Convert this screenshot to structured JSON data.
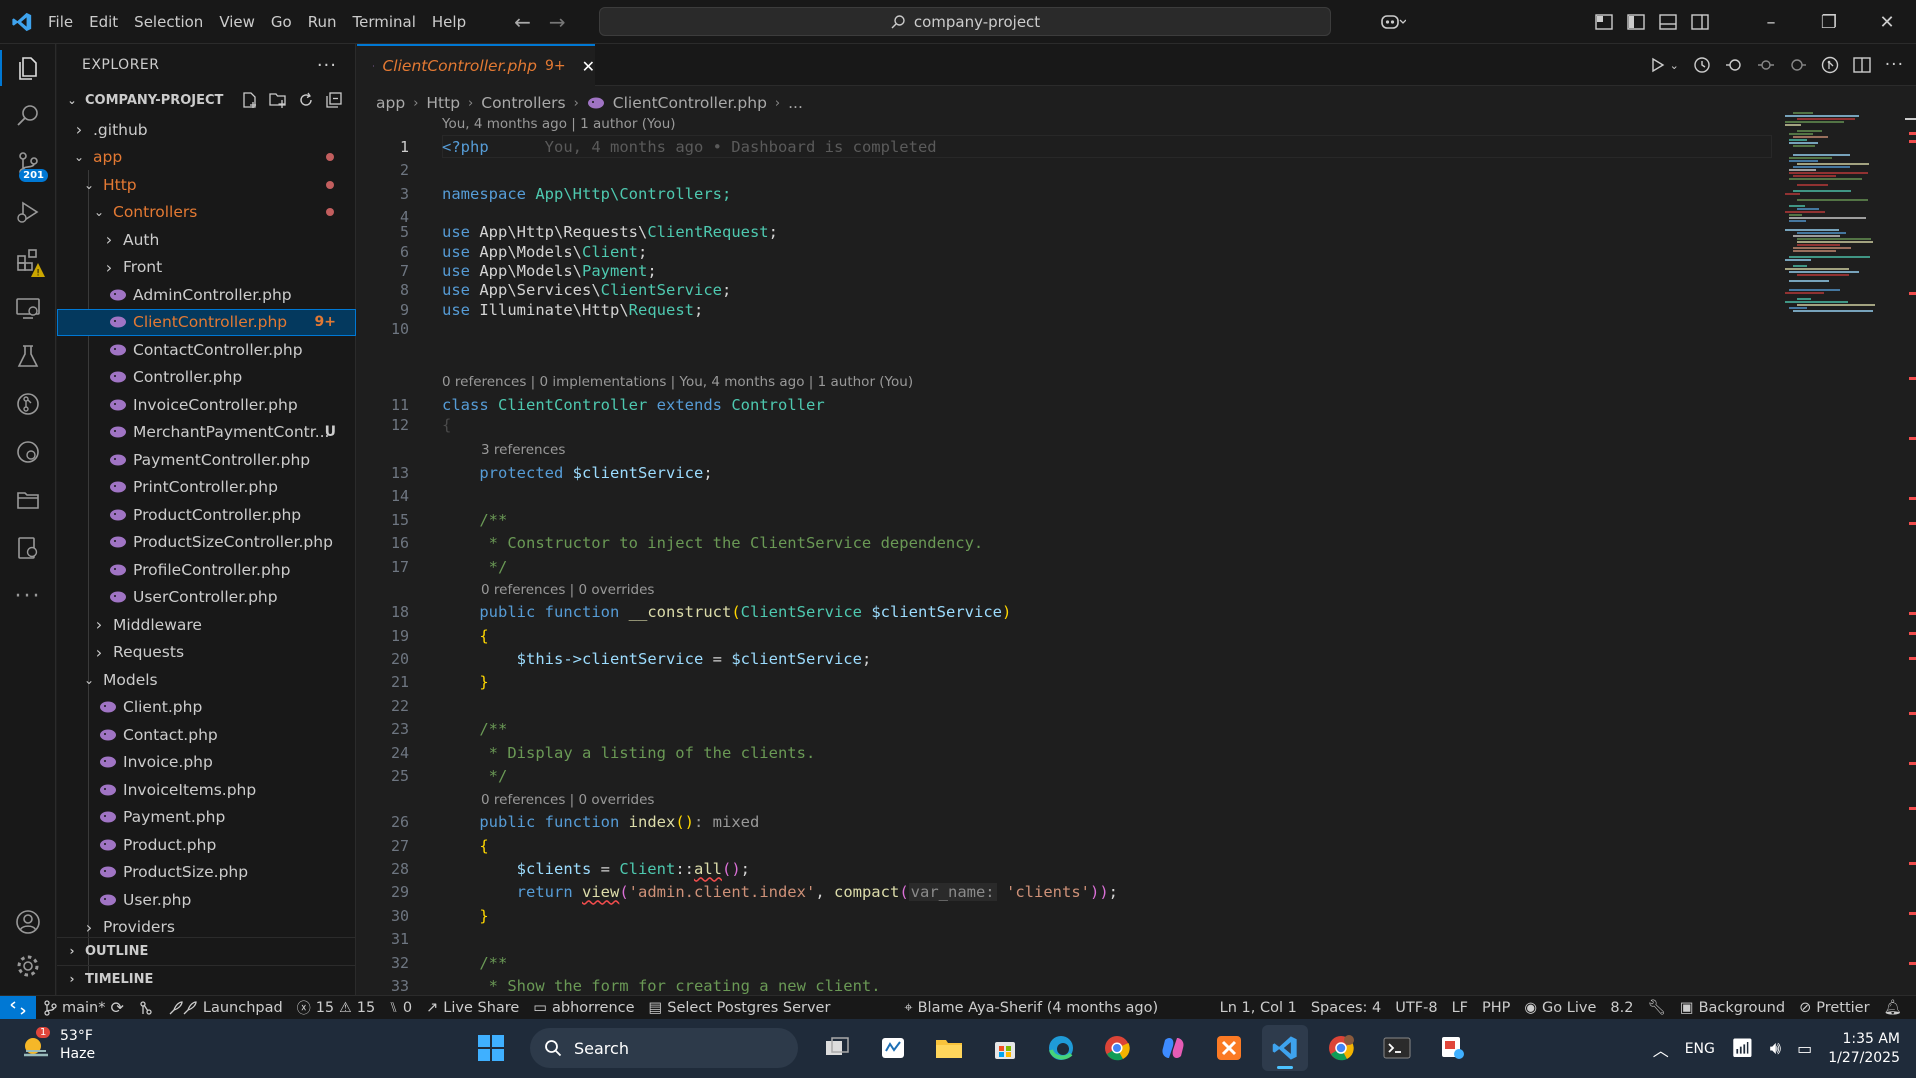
{
  "titlebar": {
    "menu": [
      "File",
      "Edit",
      "Selection",
      "View",
      "Go",
      "Run",
      "Terminal",
      "Help"
    ],
    "search": "company-project"
  },
  "activity": {
    "scm_badge": "201"
  },
  "explorer": {
    "title": "EXPLORER",
    "project": "COMPANY-PROJECT",
    "outline": "OUTLINE",
    "timeline": "TIMELINE",
    "tree": [
      {
        "label": ".github",
        "depth": 1,
        "type": "folder",
        "open": false,
        "color": "#cccccc"
      },
      {
        "label": "app",
        "depth": 1,
        "type": "folder",
        "open": true,
        "color": "#e37933",
        "dot": true
      },
      {
        "label": "Http",
        "depth": 2,
        "type": "folder",
        "open": true,
        "color": "#e37933",
        "dot": true
      },
      {
        "label": "Controllers",
        "depth": 3,
        "type": "folder",
        "open": true,
        "color": "#e37933",
        "dot": true
      },
      {
        "label": "Auth",
        "depth": 4,
        "type": "folder",
        "open": false,
        "color": "#cccccc"
      },
      {
        "label": "Front",
        "depth": 4,
        "type": "folder",
        "open": false,
        "color": "#cccccc"
      },
      {
        "label": "AdminController.php",
        "depth": 4,
        "type": "php",
        "color": "#cccccc"
      },
      {
        "label": "ClientController.php",
        "depth": 4,
        "type": "php",
        "color": "#e37933",
        "badge": "9+",
        "selected": true
      },
      {
        "label": "ContactController.php",
        "depth": 4,
        "type": "php",
        "color": "#cccccc"
      },
      {
        "label": "Controller.php",
        "depth": 4,
        "type": "php",
        "color": "#cccccc"
      },
      {
        "label": "InvoiceController.php",
        "depth": 4,
        "type": "php",
        "color": "#cccccc"
      },
      {
        "label": "MerchantPaymentContr...",
        "depth": 4,
        "type": "php",
        "color": "#cccccc",
        "badge": "U"
      },
      {
        "label": "PaymentController.php",
        "depth": 4,
        "type": "php",
        "color": "#cccccc"
      },
      {
        "label": "PrintController.php",
        "depth": 4,
        "type": "php",
        "color": "#cccccc"
      },
      {
        "label": "ProductController.php",
        "depth": 4,
        "type": "php",
        "color": "#cccccc"
      },
      {
        "label": "ProductSizeController.php",
        "depth": 4,
        "type": "php",
        "color": "#cccccc"
      },
      {
        "label": "ProfileController.php",
        "depth": 4,
        "type": "php",
        "color": "#cccccc"
      },
      {
        "label": "UserController.php",
        "depth": 4,
        "type": "php",
        "color": "#cccccc"
      },
      {
        "label": "Middleware",
        "depth": 3,
        "type": "folder",
        "open": false,
        "color": "#cccccc"
      },
      {
        "label": "Requests",
        "depth": 3,
        "type": "folder",
        "open": false,
        "color": "#cccccc"
      },
      {
        "label": "Models",
        "depth": 2,
        "type": "folder",
        "open": true,
        "color": "#cccccc"
      },
      {
        "label": "Client.php",
        "depth": 3,
        "type": "php",
        "color": "#cccccc"
      },
      {
        "label": "Contact.php",
        "depth": 3,
        "type": "php",
        "color": "#cccccc"
      },
      {
        "label": "Invoice.php",
        "depth": 3,
        "type": "php",
        "color": "#cccccc"
      },
      {
        "label": "InvoiceItems.php",
        "depth": 3,
        "type": "php",
        "color": "#cccccc"
      },
      {
        "label": "Payment.php",
        "depth": 3,
        "type": "php",
        "color": "#cccccc"
      },
      {
        "label": "Product.php",
        "depth": 3,
        "type": "php",
        "color": "#cccccc"
      },
      {
        "label": "ProductSize.php",
        "depth": 3,
        "type": "php",
        "color": "#cccccc"
      },
      {
        "label": "User.php",
        "depth": 3,
        "type": "php",
        "color": "#cccccc"
      },
      {
        "label": "Providers",
        "depth": 2,
        "type": "folder",
        "open": false,
        "color": "#cccccc"
      }
    ]
  },
  "editor": {
    "tab": {
      "label": "ClientController.php",
      "count": "9+"
    },
    "breadcrumb": [
      "app",
      "Http",
      "Controllers",
      "ClientController.php",
      "..."
    ],
    "blame_header": "You, 4 months ago | 1 author (You)",
    "line1_blame": "You, 4 months ago • Dashboard is completed",
    "lens_class": "0 references | 0 implementations | You, 4 months ago | 1 author (You)",
    "lens_refs3": "3 references",
    "lens_construct": "0 references | 0 overrides",
    "lens_index": "0 references | 0 overrides",
    "lines": {
      "l1": "<?php",
      "l3a": "namespace",
      "l3b": "App\\Http\\Controllers;",
      "l5": "App\\Http\\Requests\\",
      "l5c": "ClientRequest",
      "l6": "App\\Models\\",
      "l6c": "Client",
      "l7": "App\\Models\\",
      "l7c": "Payment",
      "l8": "App\\Services\\",
      "l8c": "ClientService",
      "l9": "Illuminate\\Http\\",
      "l9c": "Request",
      "use": "use",
      "l11a": "class",
      "l11b": "ClientController",
      "l11c": "extends",
      "l11d": "Controller",
      "l13a": "protected",
      "l13b": "$clientService",
      "l15": "/**",
      "l16": " * Constructor to inject the ClientService dependency.",
      "l17": " */",
      "l18a": "public",
      "l18b": "function",
      "l18c": "__construct",
      "l18d": "ClientService",
      "l18e": "$clientService",
      "l20a": "$this",
      "l20b": "->clientService",
      "l20c": "$clientService",
      "l23": "/**",
      "l24": " * Display a listing of the clients.",
      "l25": " */",
      "l26a": "public",
      "l26b": "function",
      "l26c": "index",
      "l26d": ": mixed",
      "l28a": "$clients",
      "l28b": "Client",
      "l28c": "all",
      "l29a": "return",
      "l29b": "view",
      "l29c": "'admin.client.index'",
      "l29d": "compact",
      "l29e": "var_name:",
      "l29f": "'clients'",
      "l32": "/**",
      "l33": " * Show the form for creating a new client."
    }
  },
  "status": {
    "branch": "main*",
    "launchpad": "Launchpad",
    "errors": "15",
    "warnings": "15",
    "ports": "0",
    "liveshare": "Live Share",
    "theme": "abhorrence",
    "postgres": "Select Postgres Server",
    "blame": "Blame Aya-Sherif (4 months ago)",
    "position": "Ln 1, Col 1",
    "spaces": "Spaces: 4",
    "encoding": "UTF-8",
    "eol": "LF",
    "lang": "PHP",
    "golive": "Go Live",
    "phpver": "8.2",
    "background": "Background",
    "prettier": "Prettier"
  },
  "taskbar": {
    "temp": "53°F",
    "weather": "Haze",
    "weather_badge": "1",
    "search": "Search",
    "lang": "ENG",
    "time": "1:35 AM",
    "date": "1/27/2025"
  },
  "colors": {
    "accent": "#0078d4",
    "modified": "#e37933",
    "error": "#f14c4c"
  }
}
